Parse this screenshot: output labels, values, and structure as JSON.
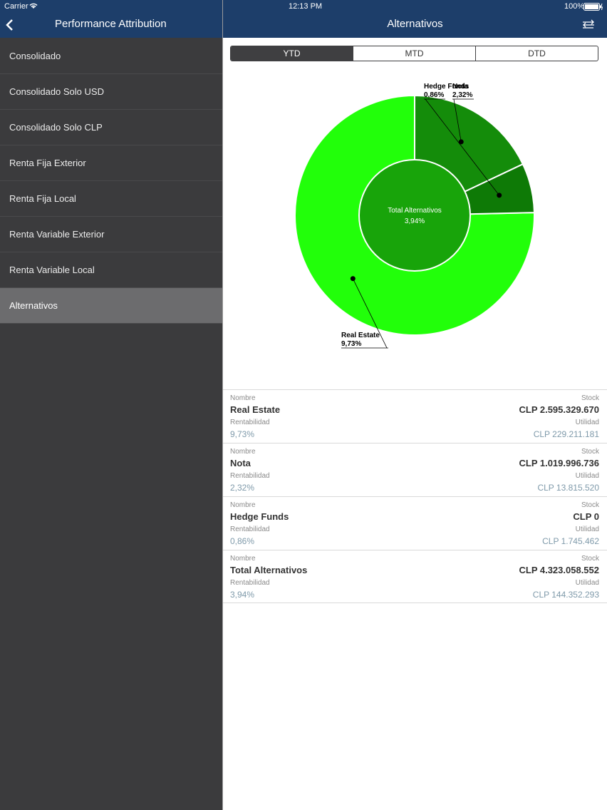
{
  "status_bar": {
    "carrier": "Carrier",
    "time": "12:13 PM",
    "battery": "100%"
  },
  "left_nav": {
    "title": "Performance Attribution"
  },
  "right_nav": {
    "title": "Alternativos"
  },
  "menu": [
    {
      "label": "Consolidado"
    },
    {
      "label": "Consolidado Solo USD"
    },
    {
      "label": "Consolidado Solo CLP"
    },
    {
      "label": "Renta Fija Exterior"
    },
    {
      "label": "Renta Fija Local"
    },
    {
      "label": "Renta Variable Exterior"
    },
    {
      "label": "Renta Variable Local"
    },
    {
      "label": "Alternativos"
    }
  ],
  "segments": [
    "YTD",
    "MTD",
    "DTD"
  ],
  "selected_segment": "YTD",
  "colors": {
    "navbar": "#1d3e6a",
    "donut_outer": "#22ff0a",
    "donut_inner": "#18a40a",
    "slice_dark": "#148c0a",
    "slice_mid": "#0e7a06"
  },
  "chart_data": {
    "type": "pie",
    "center_label": "Total Alternativos",
    "center_value": "3,94%",
    "slices": [
      {
        "name": "Real Estate",
        "label": "9,73%",
        "value": 9.73
      },
      {
        "name": "Nota",
        "label": "2,32%",
        "value": 2.32
      },
      {
        "name": "Hedge Funds",
        "label": "0,86%",
        "value": 0.86
      }
    ]
  },
  "table": {
    "labels": {
      "nombre": "Nombre",
      "stock": "Stock",
      "rentabilidad": "Rentabilidad",
      "utilidad": "Utilidad"
    },
    "rows": [
      {
        "name": "Real Estate",
        "stock": "CLP 2.595.329.670",
        "rent": "9,73%",
        "util": "CLP 229.211.181"
      },
      {
        "name": "Nota",
        "stock": "CLP 1.019.996.736",
        "rent": "2,32%",
        "util": "CLP 13.815.520"
      },
      {
        "name": "Hedge Funds",
        "stock": "CLP 0",
        "rent": "0,86%",
        "util": "CLP 1.745.462"
      },
      {
        "name": "Total Alternativos",
        "stock": "CLP 4.323.058.552",
        "rent": "3,94%",
        "util": "CLP 144.352.293"
      }
    ]
  }
}
